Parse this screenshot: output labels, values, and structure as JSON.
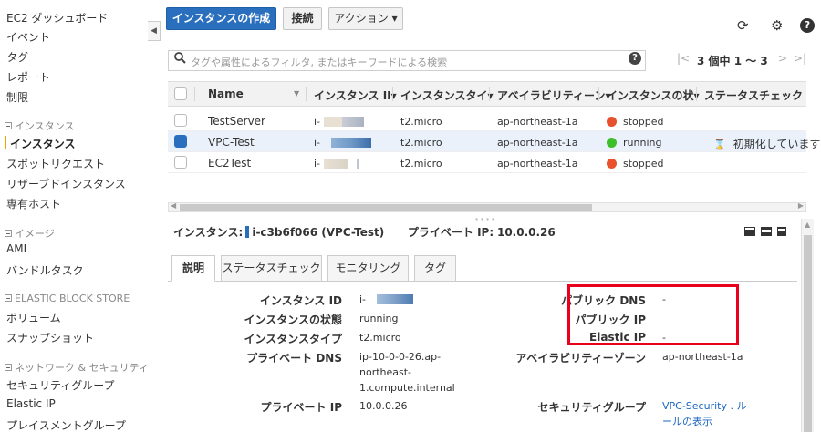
{
  "sidebar": {
    "items": [
      {
        "label": "EC2 ダッシュボード"
      },
      {
        "label": "イベント"
      },
      {
        "label": "タグ"
      },
      {
        "label": "レポート"
      },
      {
        "label": "制限"
      }
    ],
    "section_instances": "インスタンス",
    "instances_items": [
      {
        "label": "インスタンス"
      },
      {
        "label": "スポットリクエスト"
      },
      {
        "label": "リザーブドインスタンス"
      },
      {
        "label": "専有ホスト"
      }
    ],
    "section_images": "イメージ",
    "images_items": [
      {
        "label": "AMI"
      },
      {
        "label": "バンドルタスク"
      }
    ],
    "section_ebs": "ELASTIC BLOCK STORE",
    "ebs_items": [
      {
        "label": "ボリューム"
      },
      {
        "label": "スナップショット"
      }
    ],
    "section_network": "ネットワーク & セキュリティ",
    "network_items": [
      {
        "label": "セキュリティグループ"
      },
      {
        "label": "Elastic IP"
      },
      {
        "label": "プレイスメントグループ"
      }
    ],
    "collapse_glyph": "◀"
  },
  "toolbar": {
    "launch_label": "インスタンスの作成",
    "connect_label": "接続",
    "actions_label": "アクション ▾",
    "refresh_icon": "⟳",
    "settings_icon": "⚙",
    "help_icon": "?"
  },
  "search": {
    "placeholder": "タグや属性によるフィルタ, またはキーワードによる検索",
    "icon": "🔍"
  },
  "pagination": {
    "first": "|<",
    "prev": "<",
    "text": "3 個中 1 ～ 3",
    "next": ">",
    "last": ">|"
  },
  "table": {
    "headers": [
      "Name",
      "インスタンス II▾",
      "インスタンスタイ▾",
      "アベイラビリティーン▾",
      "インスタンスの状▾",
      "ステータスチェック"
    ],
    "rows": [
      {
        "name": "TestServer",
        "id_prefix": "i-",
        "type": "t2.micro",
        "zone": "ap-northeast-1a",
        "state": "stopped",
        "state_color": "#e8512c",
        "status": "",
        "selected": false
      },
      {
        "name": "VPC-Test",
        "id_prefix": "i-",
        "type": "t2.micro",
        "zone": "ap-northeast-1a",
        "state": "running",
        "state_color": "#3dbf2a",
        "status": "初期化しています",
        "selected": true
      },
      {
        "name": "EC2Test",
        "id_prefix": "i-",
        "type": "t2.micro",
        "zone": "ap-northeast-1a",
        "state": "stopped",
        "state_color": "#e8512c",
        "status": "",
        "selected": false
      }
    ],
    "hourglass_icon": "⌛"
  },
  "detail": {
    "instance_label": "インスタンス:",
    "instance_value": "i-c3b6f066 (VPC-Test)",
    "private_ip_label": "プライベート IP:",
    "private_ip_value": "10.0.0.26",
    "tabs": [
      "説明",
      "ステータスチェック",
      "モニタリング",
      "タグ"
    ],
    "left": [
      {
        "label": "インスタンス ID",
        "value": "i-"
      },
      {
        "label": "インスタンスの状態",
        "value": "running"
      },
      {
        "label": "インスタンスタイプ",
        "value": "t2.micro"
      },
      {
        "label": "プライベート DNS",
        "value": "ip-10-0-0-26.ap-"
      },
      {
        "label": "プライベート IP",
        "value": "10.0.0.26"
      }
    ],
    "dns_line2": "northeast-",
    "dns_line3": "1.compute.internal",
    "right": [
      {
        "label": "パブリック DNS",
        "value": "-"
      },
      {
        "label": "パブリック IP",
        "value": ""
      },
      {
        "label": "Elastic IP",
        "value": "-"
      },
      {
        "label": "アベイラビリティーゾーン",
        "value": "ap-northeast-1a"
      },
      {
        "label": "セキュリティグループ",
        "value": "VPC-Security . ル"
      }
    ],
    "sg_line2": "ールの表示"
  }
}
